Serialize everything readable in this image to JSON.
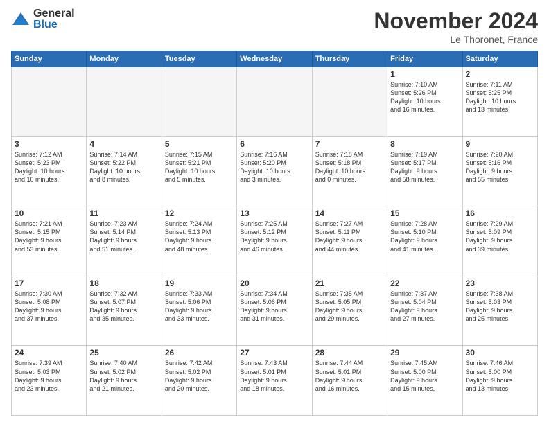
{
  "logo": {
    "general": "General",
    "blue": "Blue"
  },
  "header": {
    "month": "November 2024",
    "location": "Le Thoronet, France"
  },
  "weekdays": [
    "Sunday",
    "Monday",
    "Tuesday",
    "Wednesday",
    "Thursday",
    "Friday",
    "Saturday"
  ],
  "weeks": [
    [
      {
        "day": "",
        "info": ""
      },
      {
        "day": "",
        "info": ""
      },
      {
        "day": "",
        "info": ""
      },
      {
        "day": "",
        "info": ""
      },
      {
        "day": "",
        "info": ""
      },
      {
        "day": "1",
        "info": "Sunrise: 7:10 AM\nSunset: 5:26 PM\nDaylight: 10 hours\nand 16 minutes."
      },
      {
        "day": "2",
        "info": "Sunrise: 7:11 AM\nSunset: 5:25 PM\nDaylight: 10 hours\nand 13 minutes."
      }
    ],
    [
      {
        "day": "3",
        "info": "Sunrise: 7:12 AM\nSunset: 5:23 PM\nDaylight: 10 hours\nand 10 minutes."
      },
      {
        "day": "4",
        "info": "Sunrise: 7:14 AM\nSunset: 5:22 PM\nDaylight: 10 hours\nand 8 minutes."
      },
      {
        "day": "5",
        "info": "Sunrise: 7:15 AM\nSunset: 5:21 PM\nDaylight: 10 hours\nand 5 minutes."
      },
      {
        "day": "6",
        "info": "Sunrise: 7:16 AM\nSunset: 5:20 PM\nDaylight: 10 hours\nand 3 minutes."
      },
      {
        "day": "7",
        "info": "Sunrise: 7:18 AM\nSunset: 5:18 PM\nDaylight: 10 hours\nand 0 minutes."
      },
      {
        "day": "8",
        "info": "Sunrise: 7:19 AM\nSunset: 5:17 PM\nDaylight: 9 hours\nand 58 minutes."
      },
      {
        "day": "9",
        "info": "Sunrise: 7:20 AM\nSunset: 5:16 PM\nDaylight: 9 hours\nand 55 minutes."
      }
    ],
    [
      {
        "day": "10",
        "info": "Sunrise: 7:21 AM\nSunset: 5:15 PM\nDaylight: 9 hours\nand 53 minutes."
      },
      {
        "day": "11",
        "info": "Sunrise: 7:23 AM\nSunset: 5:14 PM\nDaylight: 9 hours\nand 51 minutes."
      },
      {
        "day": "12",
        "info": "Sunrise: 7:24 AM\nSunset: 5:13 PM\nDaylight: 9 hours\nand 48 minutes."
      },
      {
        "day": "13",
        "info": "Sunrise: 7:25 AM\nSunset: 5:12 PM\nDaylight: 9 hours\nand 46 minutes."
      },
      {
        "day": "14",
        "info": "Sunrise: 7:27 AM\nSunset: 5:11 PM\nDaylight: 9 hours\nand 44 minutes."
      },
      {
        "day": "15",
        "info": "Sunrise: 7:28 AM\nSunset: 5:10 PM\nDaylight: 9 hours\nand 41 minutes."
      },
      {
        "day": "16",
        "info": "Sunrise: 7:29 AM\nSunset: 5:09 PM\nDaylight: 9 hours\nand 39 minutes."
      }
    ],
    [
      {
        "day": "17",
        "info": "Sunrise: 7:30 AM\nSunset: 5:08 PM\nDaylight: 9 hours\nand 37 minutes."
      },
      {
        "day": "18",
        "info": "Sunrise: 7:32 AM\nSunset: 5:07 PM\nDaylight: 9 hours\nand 35 minutes."
      },
      {
        "day": "19",
        "info": "Sunrise: 7:33 AM\nSunset: 5:06 PM\nDaylight: 9 hours\nand 33 minutes."
      },
      {
        "day": "20",
        "info": "Sunrise: 7:34 AM\nSunset: 5:06 PM\nDaylight: 9 hours\nand 31 minutes."
      },
      {
        "day": "21",
        "info": "Sunrise: 7:35 AM\nSunset: 5:05 PM\nDaylight: 9 hours\nand 29 minutes."
      },
      {
        "day": "22",
        "info": "Sunrise: 7:37 AM\nSunset: 5:04 PM\nDaylight: 9 hours\nand 27 minutes."
      },
      {
        "day": "23",
        "info": "Sunrise: 7:38 AM\nSunset: 5:03 PM\nDaylight: 9 hours\nand 25 minutes."
      }
    ],
    [
      {
        "day": "24",
        "info": "Sunrise: 7:39 AM\nSunset: 5:03 PM\nDaylight: 9 hours\nand 23 minutes."
      },
      {
        "day": "25",
        "info": "Sunrise: 7:40 AM\nSunset: 5:02 PM\nDaylight: 9 hours\nand 21 minutes."
      },
      {
        "day": "26",
        "info": "Sunrise: 7:42 AM\nSunset: 5:02 PM\nDaylight: 9 hours\nand 20 minutes."
      },
      {
        "day": "27",
        "info": "Sunrise: 7:43 AM\nSunset: 5:01 PM\nDaylight: 9 hours\nand 18 minutes."
      },
      {
        "day": "28",
        "info": "Sunrise: 7:44 AM\nSunset: 5:01 PM\nDaylight: 9 hours\nand 16 minutes."
      },
      {
        "day": "29",
        "info": "Sunrise: 7:45 AM\nSunset: 5:00 PM\nDaylight: 9 hours\nand 15 minutes."
      },
      {
        "day": "30",
        "info": "Sunrise: 7:46 AM\nSunset: 5:00 PM\nDaylight: 9 hours\nand 13 minutes."
      }
    ]
  ]
}
